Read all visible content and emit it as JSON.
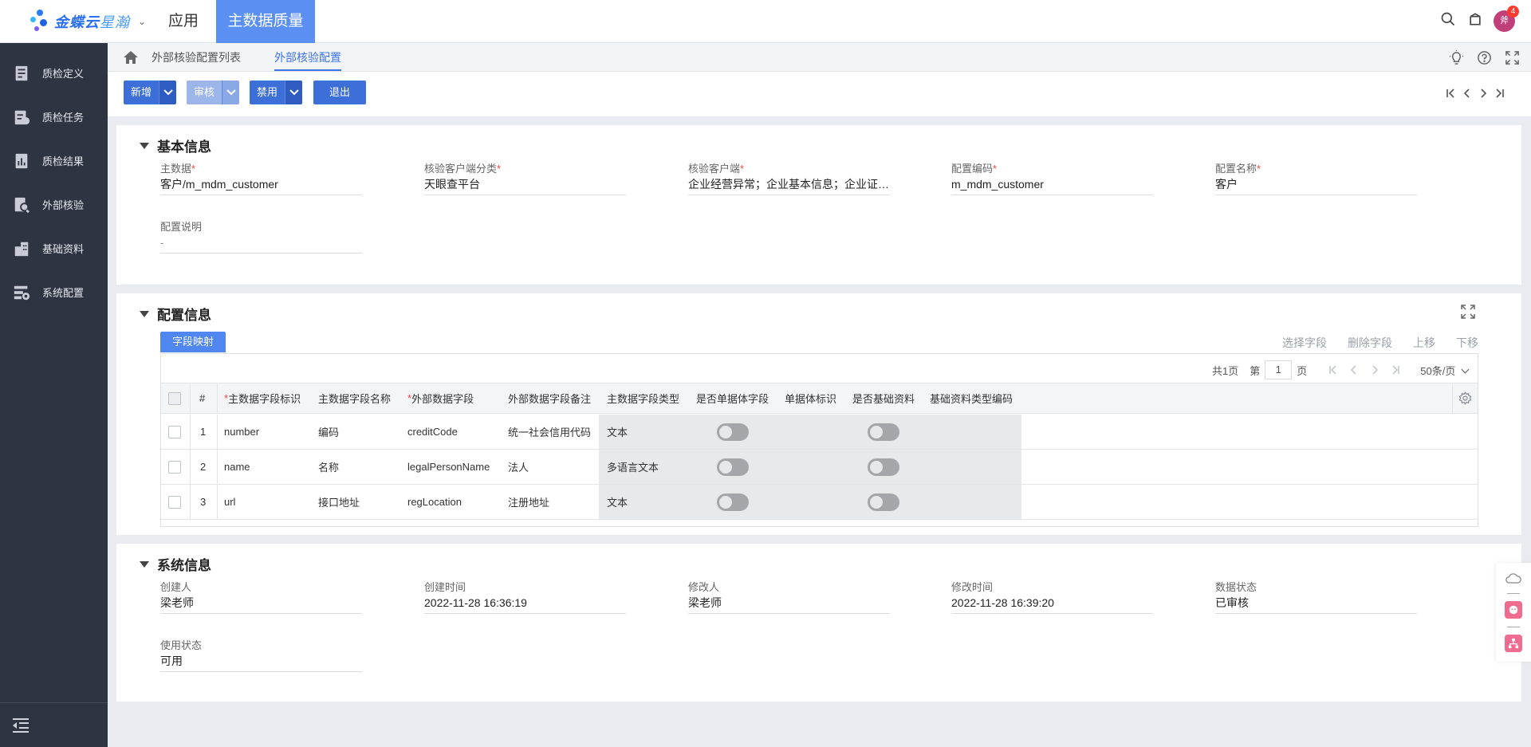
{
  "topbar": {
    "logo_text": "金蝶云",
    "logo_text_b": "星瀚",
    "tabs": [
      "应用",
      "主数据质量"
    ],
    "notification_count": "4",
    "avatar_text": "斧"
  },
  "sidebar": {
    "items": [
      {
        "label": "质检定义",
        "icon": "clipboard-icon"
      },
      {
        "label": "质检任务",
        "icon": "task-icon"
      },
      {
        "label": "质检结果",
        "icon": "result-icon"
      },
      {
        "label": "外部核验",
        "icon": "verify-icon"
      },
      {
        "label": "基础资料",
        "icon": "building-icon"
      },
      {
        "label": "系统配置",
        "icon": "settings-icon"
      }
    ]
  },
  "breadcrumb": {
    "items": [
      "外部核验配置列表",
      "外部核验配置"
    ]
  },
  "toolbar": {
    "add_label": "新增",
    "audit_label": "审核",
    "disable_label": "禁用",
    "exit_label": "退出"
  },
  "basic_info": {
    "title": "基本信息",
    "fields": [
      {
        "label": "主数据",
        "required": true,
        "value": "客户/m_mdm_customer"
      },
      {
        "label": "核验客户端分类",
        "required": true,
        "value": "天眼查平台"
      },
      {
        "label": "核验客户端",
        "required": true,
        "value": "企业经营异常；企业基本信息；企业证照信息"
      },
      {
        "label": "配置编码",
        "required": true,
        "value": "m_mdm_customer"
      },
      {
        "label": "配置名称",
        "required": true,
        "value": "客户"
      },
      {
        "label": "配置说明",
        "required": false,
        "value": "-"
      }
    ]
  },
  "config_info": {
    "title": "配置信息",
    "subtab": "字段映射",
    "actions": [
      "选择字段",
      "删除字段",
      "上移",
      "下移"
    ],
    "pager": {
      "total": "共1页",
      "page_prefix": "第",
      "page": "1",
      "page_suffix": "页",
      "page_size": "50条/页"
    },
    "columns": [
      "#",
      "主数据字段标识",
      "主数据字段名称",
      "外部数据字段",
      "外部数据字段备注",
      "主数据字段类型",
      "是否单据体字段",
      "单据体标识",
      "是否基础资料",
      "基础资料类型编码"
    ],
    "required_marker": "*",
    "rows": [
      {
        "num": "1",
        "field_id": "number",
        "field_name": "编码",
        "ext_field": "creditCode",
        "ext_remark": "统一社会信用代码",
        "field_type": "文本",
        "is_entry": false,
        "is_base": false
      },
      {
        "num": "2",
        "field_id": "name",
        "field_name": "名称",
        "ext_field": "legalPersonName",
        "ext_remark": "法人",
        "field_type": "多语言文本",
        "is_entry": false,
        "is_base": false
      },
      {
        "num": "3",
        "field_id": "url",
        "field_name": "接口地址",
        "ext_field": "regLocation",
        "ext_remark": "注册地址",
        "field_type": "文本",
        "is_entry": false,
        "is_base": false
      }
    ]
  },
  "system_info": {
    "title": "系统信息",
    "fields": [
      {
        "label": "创建人",
        "value": "梁老师"
      },
      {
        "label": "创建时间",
        "value": "2022-11-28 16:36:19"
      },
      {
        "label": "修改人",
        "value": "梁老师"
      },
      {
        "label": "修改时间",
        "value": "2022-11-28 16:39:20"
      },
      {
        "label": "数据状态",
        "value": "已审核"
      },
      {
        "label": "使用状态",
        "value": "可用"
      }
    ]
  },
  "colors": {
    "accent": "#3d6fd8",
    "active_tab": "#5b8ff2",
    "sidebar_bg": "#2f3443"
  }
}
